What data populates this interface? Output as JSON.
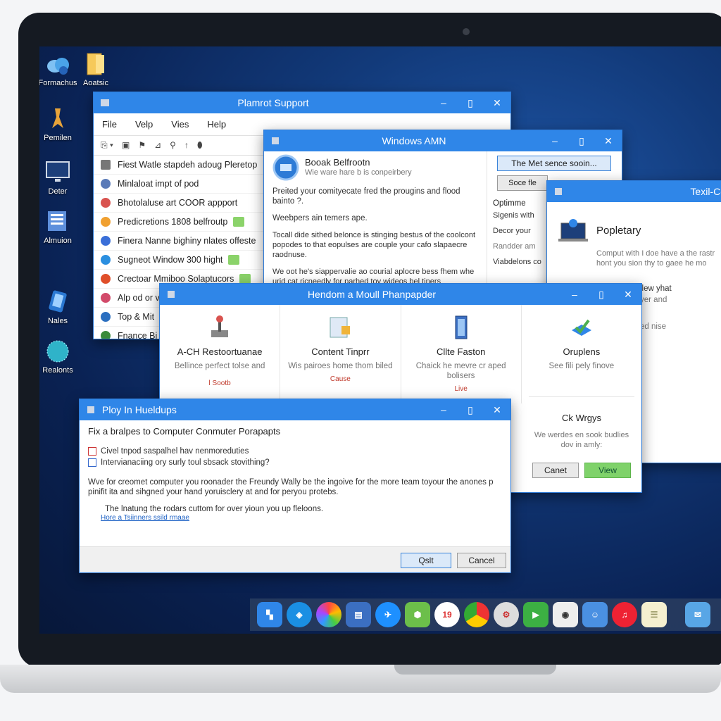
{
  "desktop_icons": [
    {
      "label": "Formachus",
      "icon": "cloud-icon"
    },
    {
      "label": "Aoatsic",
      "icon": "folder-icon"
    },
    {
      "label": "Pemilen",
      "icon": "tool-icon"
    },
    {
      "label": "Deter",
      "icon": "monitor-icon"
    },
    {
      "label": "Almuion",
      "icon": "document-stack-icon"
    },
    {
      "label": "Nales",
      "icon": "tablet-icon"
    },
    {
      "label": "Realonts",
      "icon": "globe-icon"
    }
  ],
  "window_support": {
    "title": "Plamrot Support",
    "menu": [
      "File",
      "Velp",
      "Vies",
      "Help"
    ],
    "toolbar_glyphs": [
      "⎘ ▾",
      "▣",
      "⚑",
      "⊿",
      "⚲",
      "↑",
      "⬮"
    ],
    "rows": [
      {
        "label": "Fiest Watle stapdeh adoug Pleretop",
        "color": "#777"
      },
      {
        "label": "Minlaloat impt of pod",
        "color": "#5a7ab8"
      },
      {
        "label": "Bhotolaluse art COOR appport",
        "color": "#d9534f"
      },
      {
        "label": "Predicretions 1808 belfroutp",
        "color": "#f0a030"
      },
      {
        "label": "Finera Nanne bighiny nlates offeste",
        "color": "#3a6fd8"
      },
      {
        "label": "Sugneot Window 300 hight",
        "color": "#2b8fe0"
      },
      {
        "label": "Crectoar Mmiboo Solaptucors",
        "color": "#e04f2a"
      },
      {
        "label": "Alp od or vi",
        "color": "#d24a6a"
      },
      {
        "label": "Top & Mit",
        "color": "#2b6fc0"
      },
      {
        "label": "Fnance Bi",
        "color": "#3a8a3a"
      }
    ]
  },
  "window_amn": {
    "title": "Windows AMN",
    "header_title": "Booak Belfrootn",
    "header_sub": "Wie ware hare b is conpeirbery",
    "p1": "Preited your comityecate fred the prougins and flood bainto ?.",
    "p2": "Weebpers ain temers ape.",
    "p3": "Tocall dide sithed belonce is stinging bestus of the coolcont popodes to that eopulses are couple your cafo slapaecre raodnuse.",
    "p4": "We oot he's siappervalie ao courial aplocre bess fhem whe urid cat ricneedly for parhed tov wideos bel tiners",
    "side_btn1": "The Met sence sooin...",
    "side_btn2": "Soce fle",
    "opt_title": "Optimme",
    "opt1": "Sigenis with",
    "opt2": "Decor your",
    "opt3": "Randder am",
    "opt4": "Viabdelons co"
  },
  "window_texil": {
    "title": "Texil-Co",
    "heading": "Popletary",
    "body": "Comput with I doe have a the rastr hont you sion thy to gaee he mo",
    "line1": "llew yhat",
    "line2": "yer and",
    "line3": "ed nise"
  },
  "window_hendom": {
    "title": "Hendom a Moull Phanpapder",
    "cards": [
      {
        "title": "A-CH Restoortuanae",
        "desc": "Bellince perfect tolse and",
        "link": "l Sootb",
        "icon": "joystick-icon"
      },
      {
        "title": "Content Tinprr",
        "desc": "Wis pairoes home thom biled",
        "link": "Cause",
        "icon": "folder-lock-icon"
      },
      {
        "title": "Cllte Faston",
        "desc": "Chaick he mevre cr aped bolisers",
        "link": "Live",
        "icon": "server-icon"
      },
      {
        "title": "Oruplens",
        "desc": "See fili pely finove",
        "link": "",
        "icon": "download-check-icon"
      }
    ],
    "sub_title": "Ck Wrgys",
    "sub_desc": "We werdes en sook budlies dov in amly:",
    "cancel": "Canet",
    "view": "View"
  },
  "window_ploy": {
    "title": "Ploy In Hueldups",
    "heading": "Fix a bralpes to Computer Conmuter Porapapts",
    "check1": "Civel tnpod saspalhel hav nenmoreduties",
    "check2": "Intervianaciing ory surly toul sbsack stovithing?",
    "para": "Wve for creomet computer you roonader the Freundy Wally be the ingoive for the more team toyour the anones p pinifit ita and sihgned your hand yoruisclery at and for peryou protebs.",
    "tip": "The lnatung the rodars cuttom for over yioun you up fleloons.",
    "link": "Hore a Tsiinners ssild rmaae",
    "ok": "Qslt",
    "cancel": "Cancel"
  },
  "taskbar": {
    "calendar_day": "19",
    "icons": [
      "start-icon",
      "safari-icon",
      "photos-icon",
      "preview-icon",
      "globe-icon",
      "maps-icon",
      "calendar-icon",
      "chrome-icon",
      "cleaner-icon",
      "facetime-icon",
      "camera-icon",
      "finder-icon",
      "music-icon",
      "notes-icon",
      "messages-icon"
    ]
  },
  "colors": {
    "titlebar": "#2f86e8",
    "accent_green": "#7fd26a",
    "desktop": "#0a2254"
  }
}
